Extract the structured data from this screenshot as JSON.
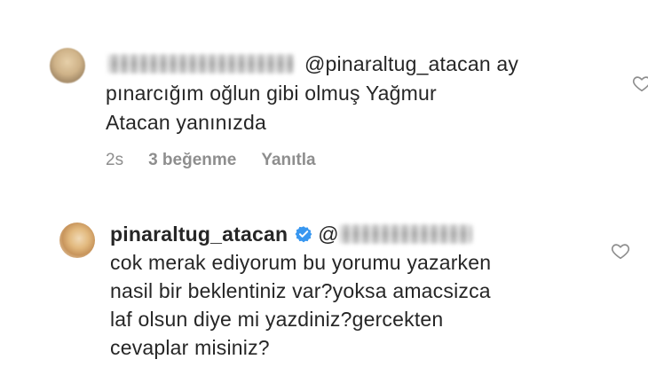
{
  "comments": [
    {
      "mention": "@pinaraltug_atacan",
      "lines": [
        "ay",
        "pınarcığım oğlun gibi olmuş Yağmur",
        "Atacan yanınızda"
      ],
      "time": "2s",
      "likes": "3 beğenme",
      "reply": "Yanıtla"
    },
    {
      "username": "pinaraltug_atacan",
      "mention_prefix": "@",
      "lines": [
        "cok merak ediyorum bu yorumu yazarken",
        "nasil bir beklentiniz var?yoksa amacsizca",
        "laf olsun diye mi yazdiniz?gercekten",
        "cevaplar misiniz?"
      ]
    }
  ],
  "icons": {
    "heart": "heart-outline-icon",
    "verified": "verified-badge-icon"
  },
  "colors": {
    "text": "#262626",
    "meta": "#8e8e8e",
    "verified": "#3897f0",
    "heart_stroke": "#8e8e8e"
  }
}
